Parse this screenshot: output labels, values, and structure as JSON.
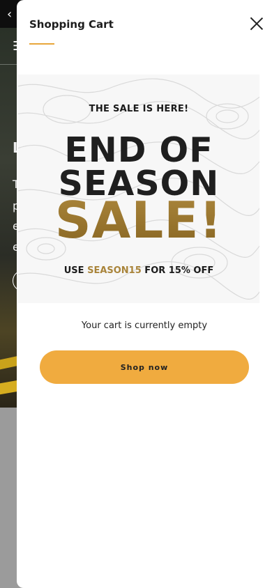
{
  "background_page": {
    "back_icon": "‹",
    "menu_icon": "☰",
    "letters": [
      "L",
      "T",
      "p",
      "e",
      "e"
    ]
  },
  "drawer": {
    "title": "Shopping Cart",
    "close_icon": "close-icon",
    "accent_color": "#e8a63a"
  },
  "promo": {
    "kicker": "THE SALE IS HERE!",
    "line1": "END OF",
    "line2": "SEASON",
    "sale": "SALE!",
    "code_prefix": "USE ",
    "code": "SEASON15",
    "code_suffix": " FOR 15% OFF",
    "gold_color": "#a9843a"
  },
  "cart": {
    "empty_message": "Your cart is currently empty",
    "shop_button_label": "Shop now",
    "button_color": "#f0ab3f"
  }
}
